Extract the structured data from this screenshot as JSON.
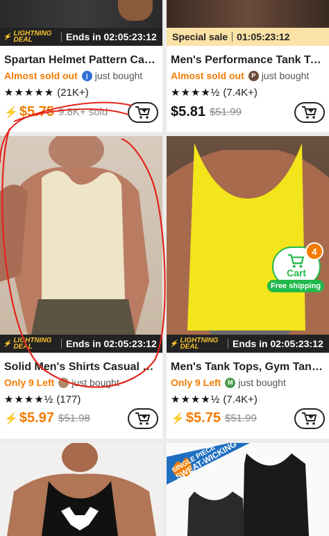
{
  "products": [
    {
      "banner": {
        "label": "LIGHTNING DEAL",
        "text": "Ends in 02:05:23:12"
      },
      "title": "Spartan Helmet Pattern Cas...",
      "alert": "Almost sold out",
      "bought": {
        "avatar_letter": "j",
        "avatar_color": "#2f6fd6",
        "text": "just bought"
      },
      "rating": {
        "stars": "★★★★★",
        "count": "(21K+)"
      },
      "price": "$5.75",
      "sold": "9.8K+ sold"
    },
    {
      "banner": {
        "label": "Special sale",
        "text": "01:05:23:12"
      },
      "title": "Men's Performance Tank To...",
      "alert": "Almost sold out",
      "bought": {
        "avatar_letter": "P",
        "avatar_color": "#6b4a3a",
        "text": "just bought"
      },
      "rating": {
        "stars": "★★★★½",
        "count": "(7.4K+)"
      },
      "price": "$5.81",
      "old_price": "$51.99"
    },
    {
      "banner": {
        "label": "LIGHTNING DEAL",
        "text": "Ends in 02:05:23:12"
      },
      "title": "Solid Men's Shirts Casual Br...",
      "alert": "Only 9 Left",
      "bought": {
        "avatar_letter": "",
        "avatar_color": "#b08a6a",
        "text": "just bought"
      },
      "rating": {
        "stars": "★★★★½",
        "count": "(177)"
      },
      "price": "$5.97",
      "old_price": "$51.98"
    },
    {
      "banner": {
        "label": "LIGHTNING DEAL",
        "text": "Ends in 02:05:23:12"
      },
      "title": "Men's Tank Tops, Gym Tank...",
      "alert": "Only 9 Left",
      "bought": {
        "avatar_letter": "M",
        "avatar_color": "#4a9a4a",
        "text": "just bought"
      },
      "rating": {
        "stars": "★★★★½",
        "count": "(7.4K+)"
      },
      "price": "$5.75",
      "old_price": "$51.99"
    },
    {
      "badge_text": [
        "SINGLE PIECE",
        "SWEAT-WICKING"
      ]
    }
  ],
  "floating_cart": {
    "label": "Cart",
    "count": "4",
    "shipping": "Free shipping"
  },
  "colors": {
    "accent": "#f47b00",
    "green": "#1fb84a",
    "annotation": "#e2231a"
  }
}
